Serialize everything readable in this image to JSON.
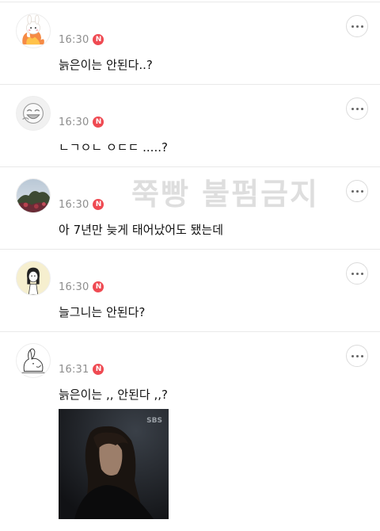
{
  "watermark": "쭉빵 불펌금지",
  "comments": [
    {
      "time": "16:30",
      "badge": "N",
      "text": "늙은이는 안된다..?",
      "avatar_icon": "flame-rabbit-avatar"
    },
    {
      "time": "16:30",
      "badge": "N",
      "text": "ㄴㄱㅇㄴ ㅇㄷㄷ .....?",
      "avatar_icon": "laughing-face-avatar"
    },
    {
      "time": "16:30",
      "badge": "N",
      "text": "아 7년만 늦게 태어났어도 됐는데",
      "avatar_icon": "tree-photo-avatar"
    },
    {
      "time": "16:30",
      "badge": "N",
      "text": "늘그니는 안된다?",
      "avatar_icon": "girl-drawing-avatar"
    },
    {
      "time": "16:31",
      "badge": "N",
      "text": "늙은이는 ,, 안된다 ,,?",
      "avatar_icon": "rabbit-sketch-avatar",
      "has_photo": true
    }
  ],
  "photo_logo": "SBS",
  "colors": {
    "badge": "#ef4a52",
    "time": "#8e8e8e",
    "divider": "#e9e9e9",
    "watermark": "#d3d3d3"
  },
  "more_icon": "more-dots-icon"
}
